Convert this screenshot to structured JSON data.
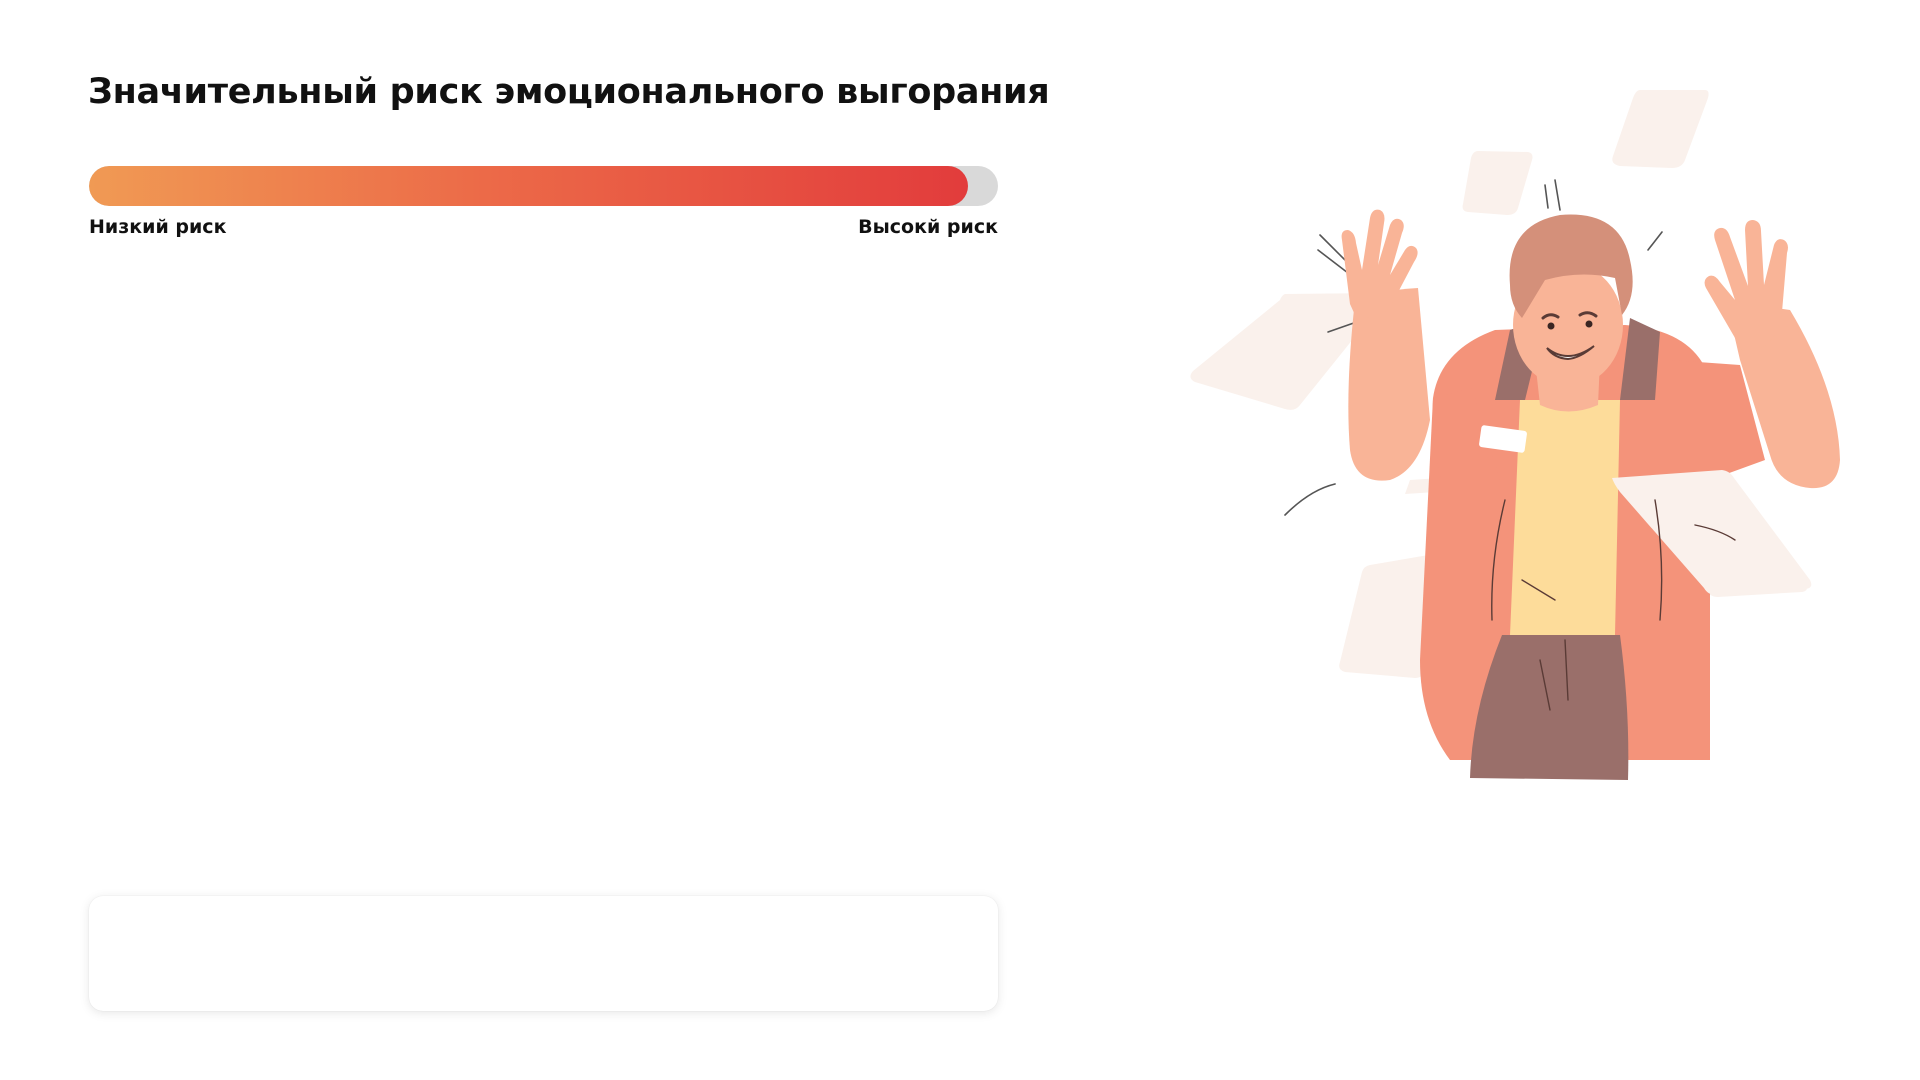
{
  "result": {
    "title": "Значительный риск эмоционального выгорания",
    "risk_level": 0.967,
    "low_label": "Низкий риск",
    "high_label": "Высокй риск"
  },
  "colors": {
    "gradient_start": "#f09a54",
    "gradient_end": "#e23c3c",
    "track": "#d9d9d9",
    "jacket": "#f4937a",
    "shirt": "#fddc9a",
    "hair": "#d4907a",
    "pants": "#9a6f6a",
    "paper": "#faf1ec"
  },
  "illustration": {
    "icon": "stressed-man-papers-illustration"
  }
}
